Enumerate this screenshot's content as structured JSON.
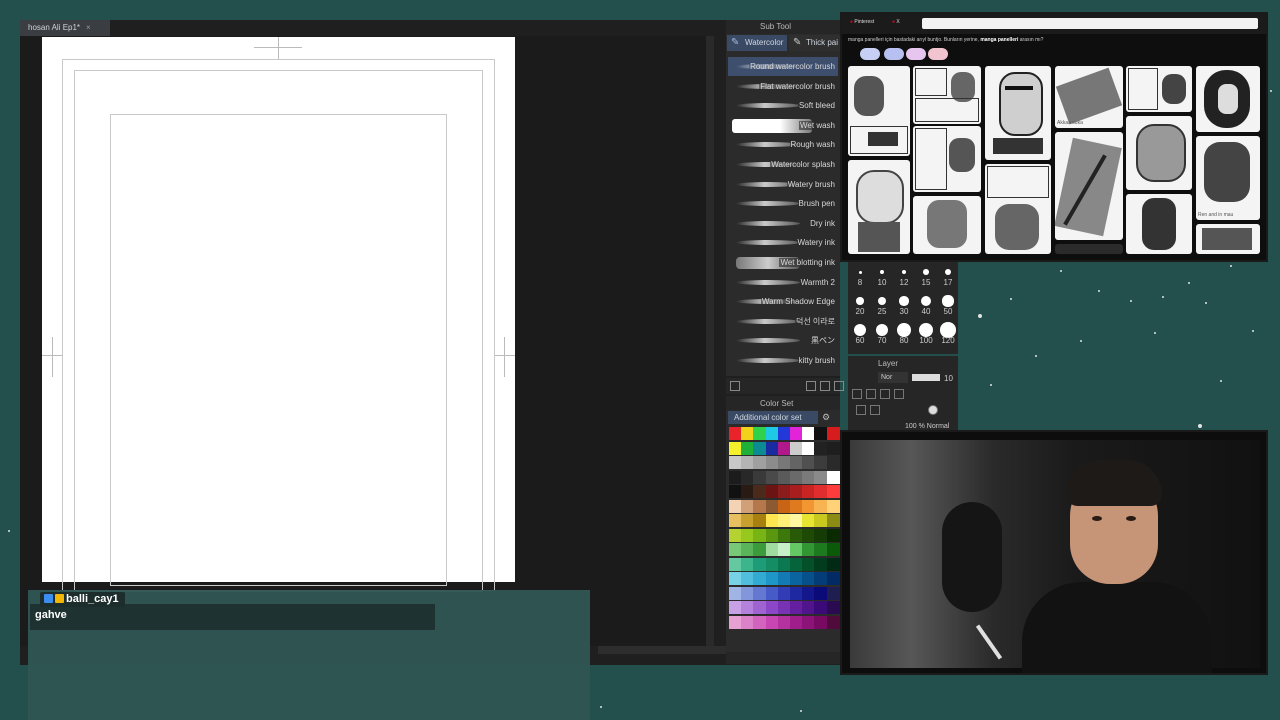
{
  "document": {
    "tab_label": "hosan Ali Ep1*",
    "close_glyph": "×"
  },
  "subtool": {
    "title": "Sub Tool",
    "tabs": [
      {
        "label": "Watercolor",
        "icon": "brush-icon"
      },
      {
        "label": "Thick pai",
        "icon": "brush-icon"
      }
    ],
    "brushes": [
      "Round watercolor brush",
      "Flat watercolor brush",
      "Soft bleed",
      "Wet wash",
      "Rough wash",
      "Watercolor splash",
      "Watery brush",
      "Brush pen",
      "Dry ink",
      "Watery ink",
      "Wet blotting ink",
      "Warmth 2",
      "Warm Shadow Edge",
      "덕선 이라로",
      "黒ペン",
      "kitty brush"
    ],
    "selected_index": 0
  },
  "colorset": {
    "title": "Color Set",
    "selected_set": "Additional color set",
    "swatches": [
      "#e8242a",
      "#f2d21b",
      "#2fd24a",
      "#1ec9e6",
      "#2238d8",
      "#e224d8",
      "#ffffff",
      "#111111",
      "#d61c1c",
      "#f4f02c",
      "#1fb03a",
      "#0c8c92",
      "#1a2aa0",
      "#b0188c",
      "#cccccc",
      "#ffffff",
      "#222222",
      "#1e1e1e",
      "#c8c8c8",
      "#b4b4b4",
      "#a0a0a0",
      "#8c8c8c",
      "#787878",
      "#646464",
      "#505050",
      "#3c3c3c",
      "#2a2a2a",
      "#1c1c1c",
      "#282828",
      "#3a3a3a",
      "#4a4a4a",
      "#5a5a5a",
      "#6a6a6a",
      "#7a7a7a",
      "#8a8a8a",
      "#ffffff",
      "#111111",
      "#2a1a14",
      "#4a2a1a",
      "#6a1414",
      "#8a1c1c",
      "#a81e1e",
      "#c82424",
      "#e02e2e",
      "#ff3c3c",
      "#f4d2b4",
      "#d2a078",
      "#b4784c",
      "#8c5a32",
      "#c86414",
      "#e07a1e",
      "#f29632",
      "#f8b450",
      "#ffd278",
      "#e8c060",
      "#c8a030",
      "#a88010",
      "#ffe650",
      "#fff078",
      "#fff8a0",
      "#e6e632",
      "#c8c81e",
      "#8c8c14",
      "#b4d232",
      "#96c81e",
      "#78b414",
      "#5a960e",
      "#3c780a",
      "#285a08",
      "#1e4a06",
      "#143c04",
      "#0a2a02",
      "#78c878",
      "#5ab45a",
      "#3c9c3c",
      "#a0dca0",
      "#c8f0c8",
      "#64c864",
      "#329632",
      "#1e7a1e",
      "#0a5a0a",
      "#64c8a0",
      "#3cb48c",
      "#1e9c78",
      "#148c64",
      "#0a7850",
      "#06643c",
      "#045028",
      "#023c1e",
      "#012a14",
      "#78d2e6",
      "#50bedc",
      "#32aad2",
      "#1e96c8",
      "#147ab4",
      "#0a64a0",
      "#06508c",
      "#043c78",
      "#022a64",
      "#a0b4e6",
      "#8296dc",
      "#6478d2",
      "#465ac8",
      "#323cb4",
      "#1e28a0",
      "#14168c",
      "#0a0a78",
      "#1e1e50",
      "#c8a0e6",
      "#b482dc",
      "#a064d2",
      "#8c46c8",
      "#7832b4",
      "#641ea0",
      "#50148c",
      "#3c0a78",
      "#2a0a50",
      "#e6a0d2",
      "#dc82c8",
      "#d264be",
      "#c846b4",
      "#b432a0",
      "#a01e8c",
      "#8c1478",
      "#780a64",
      "#500a3c"
    ]
  },
  "brush_sizes": [
    "8",
    "10",
    "12",
    "15",
    "17",
    "20",
    "25",
    "30",
    "40",
    "50",
    "60",
    "70",
    "80",
    "100",
    "120"
  ],
  "layer": {
    "title": "Layer",
    "blend_label": "Nor",
    "opacity_label": "10",
    "row_text": "100 % Normal"
  },
  "browser": {
    "tabs": [
      "Pinterest",
      "X"
    ],
    "address": "",
    "search_line_prefix": "manga panelleri için bastadaki arıyl buntjo. Bunların yerine, ",
    "search_line_bold": "manga panelleri",
    "search_line_suffix": " arasın mı?",
    "caption_1": "Akkaa suka",
    "caption_2": "Ren and in mau"
  },
  "chat": {
    "username": "balli_cay1",
    "message": "gahve"
  },
  "colors": {
    "background": "#234f4c",
    "chat_bg": "#2f5552",
    "accent_selection": "#3e4f6e"
  }
}
